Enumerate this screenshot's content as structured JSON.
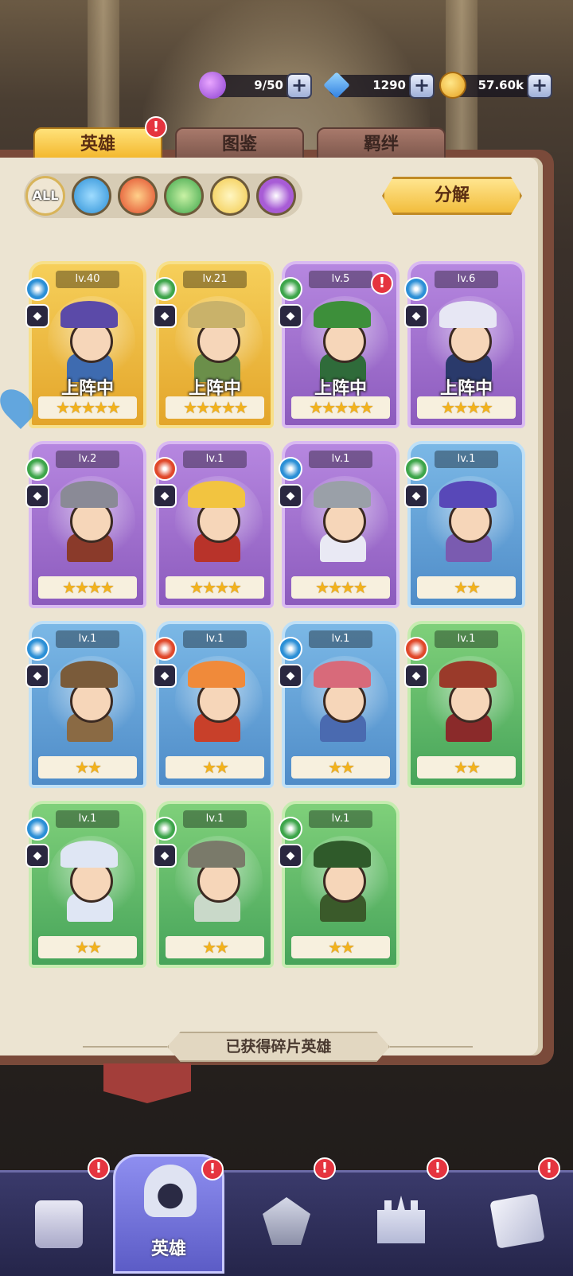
{
  "resources": {
    "stamina": {
      "value": "9/50",
      "icon": "potion-icon"
    },
    "gems": {
      "value": "1290",
      "icon": "diamond-icon"
    },
    "gold": {
      "value": "57.60k",
      "icon": "coin-icon"
    }
  },
  "tabs": [
    {
      "label": "英雄",
      "active": true,
      "badge": "!"
    },
    {
      "label": "图鉴",
      "active": false
    },
    {
      "label": "羁绊",
      "active": false
    }
  ],
  "filters": {
    "all_label": "ALL",
    "elements": [
      "water-element-icon",
      "fire-element-icon",
      "nature-element-icon",
      "light-element-icon",
      "dark-element-icon"
    ],
    "element_colors": {
      "water": "#2b8fd6",
      "fire": "#e0482a",
      "nature": "#3da54a",
      "light": "#f2c94a",
      "dark": "#a85cd6"
    }
  },
  "decompose_label": "分解",
  "heroes": [
    {
      "level": "lv.40",
      "rarity": "gold",
      "element": "water",
      "class_icon": "mage-class-icon",
      "stars": 5,
      "on_team_label": "上阵中",
      "alert": false
    },
    {
      "level": "lv.21",
      "rarity": "gold",
      "element": "nature",
      "class_icon": "archer-class-icon",
      "stars": 5,
      "on_team_label": "上阵中",
      "alert": false
    },
    {
      "level": "lv.5",
      "rarity": "purple",
      "element": "nature",
      "class_icon": "archer-class-icon",
      "stars": 5,
      "on_team_label": "上阵中",
      "alert": true
    },
    {
      "level": "lv.6",
      "rarity": "purple",
      "element": "water",
      "class_icon": "support-class-icon",
      "stars": 4,
      "on_team_label": "上阵中",
      "alert": false
    },
    {
      "level": "lv.2",
      "rarity": "purple",
      "element": "nature",
      "class_icon": "archer-class-icon",
      "stars": 4,
      "on_team_label": "",
      "alert": false
    },
    {
      "level": "lv.1",
      "rarity": "purple",
      "element": "fire",
      "class_icon": "tank-class-icon",
      "stars": 4,
      "on_team_label": "",
      "alert": false
    },
    {
      "level": "lv.1",
      "rarity": "purple",
      "element": "water",
      "class_icon": "tank-class-icon",
      "stars": 4,
      "on_team_label": "",
      "alert": false
    },
    {
      "level": "lv.1",
      "rarity": "blue",
      "element": "nature",
      "class_icon": "mage-class-icon",
      "stars": 2,
      "on_team_label": "",
      "alert": false
    },
    {
      "level": "lv.1",
      "rarity": "blue",
      "element": "water",
      "class_icon": "warrior-class-icon",
      "stars": 2,
      "on_team_label": "",
      "alert": false
    },
    {
      "level": "lv.1",
      "rarity": "blue",
      "element": "fire",
      "class_icon": "archer-class-icon",
      "stars": 2,
      "on_team_label": "",
      "alert": false
    },
    {
      "level": "lv.1",
      "rarity": "blue",
      "element": "water",
      "class_icon": "archer-class-icon",
      "stars": 2,
      "on_team_label": "",
      "alert": false
    },
    {
      "level": "lv.1",
      "rarity": "green",
      "element": "fire",
      "class_icon": "mage-class-icon",
      "stars": 2,
      "on_team_label": "",
      "alert": false
    },
    {
      "level": "lv.1",
      "rarity": "green",
      "element": "water",
      "class_icon": "mage-class-icon",
      "stars": 2,
      "on_team_label": "",
      "alert": false
    },
    {
      "level": "lv.1",
      "rarity": "green",
      "element": "nature",
      "class_icon": "support-class-icon",
      "stars": 2,
      "on_team_label": "",
      "alert": false
    },
    {
      "level": "lv.1",
      "rarity": "green",
      "element": "nature",
      "class_icon": "warrior-class-icon",
      "stars": 2,
      "on_team_label": "",
      "alert": false
    }
  ],
  "obtained_fragments_label": "已获得碎片英雄",
  "nav": [
    {
      "label": "",
      "icon": "shop-icon",
      "badge": "!"
    },
    {
      "label": "英雄",
      "icon": "helmet-icon",
      "badge": "!",
      "active": true
    },
    {
      "label": "",
      "icon": "battle-emblem-icon",
      "badge": "!"
    },
    {
      "label": "",
      "icon": "castle-icon",
      "badge": "!"
    },
    {
      "label": "",
      "icon": "map-scroll-icon",
      "badge": "!"
    }
  ]
}
